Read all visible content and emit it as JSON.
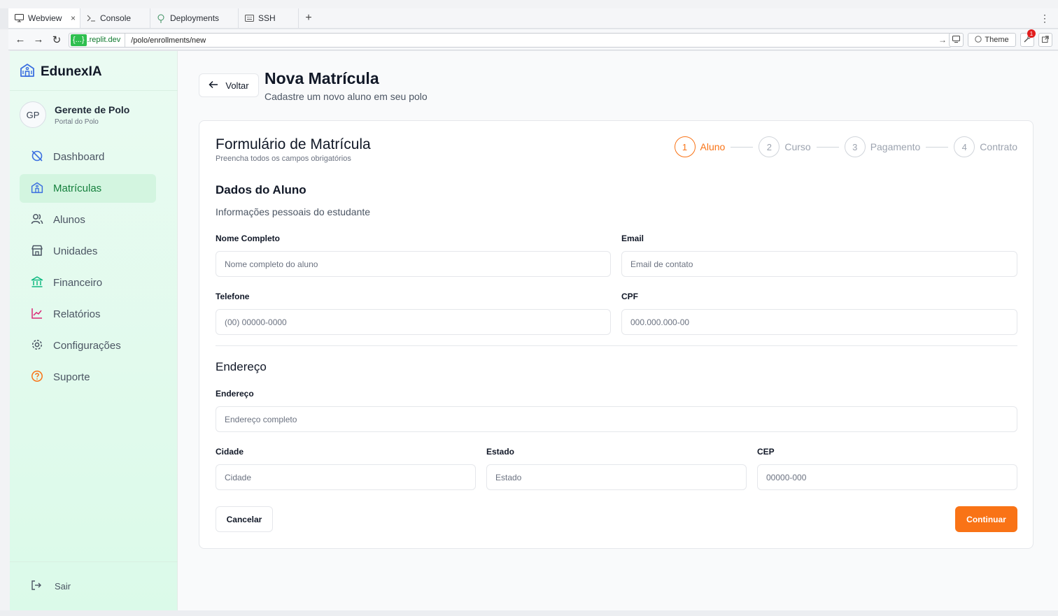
{
  "browser": {
    "tabs": [
      {
        "label": "Webview",
        "icon": "monitor-icon"
      },
      {
        "label": "Console",
        "icon": "terminal-icon"
      },
      {
        "label": "Deployments",
        "icon": "deploy-icon"
      },
      {
        "label": "SSH",
        "icon": "keyboard-icon"
      }
    ],
    "tab_close": "×",
    "new_tab": "+",
    "url_host_badge": "{...}",
    "url_domain": ".replit.dev",
    "url_path": "/polo/enrollments/new",
    "theme_label": "Theme",
    "notification_count": "1"
  },
  "sidebar": {
    "brand": "EdunexIA",
    "user": {
      "initials": "GP",
      "name": "Gerente de Polo",
      "role": "Portal do Polo"
    },
    "items": [
      {
        "label": "Dashboard",
        "icon": "dashboard-icon",
        "color": "#3b6fe0"
      },
      {
        "label": "Matrículas",
        "icon": "enrollments-icon",
        "color": "#3b6fe0"
      },
      {
        "label": "Alunos",
        "icon": "users-icon",
        "color": "#4b5563"
      },
      {
        "label": "Unidades",
        "icon": "store-icon",
        "color": "#4b5563"
      },
      {
        "label": "Financeiro",
        "icon": "bank-icon",
        "color": "#10b981"
      },
      {
        "label": "Relatórios",
        "icon": "chart-line-icon",
        "color": "#db2777"
      },
      {
        "label": "Configurações",
        "icon": "gear-icon",
        "color": "#4b5563"
      },
      {
        "label": "Suporte",
        "icon": "help-circle-icon",
        "color": "#f97316"
      }
    ],
    "active_item": "Matrículas",
    "logout_label": "Sair"
  },
  "header": {
    "back_label": "Voltar",
    "title": "Nova Matrícula",
    "subtitle": "Cadastre um novo aluno em seu polo"
  },
  "form": {
    "title": "Formulário de Matrícula",
    "subtitle": "Preencha todos os campos obrigatórios",
    "steps": [
      {
        "num": "1",
        "label": "Aluno"
      },
      {
        "num": "2",
        "label": "Curso"
      },
      {
        "num": "3",
        "label": "Pagamento"
      },
      {
        "num": "4",
        "label": "Contrato"
      }
    ],
    "active_step": "Aluno",
    "section_student": {
      "title": "Dados do Aluno",
      "description": "Informações pessoais do estudante"
    },
    "fields": {
      "name": {
        "label": "Nome Completo",
        "placeholder": "Nome completo do aluno",
        "value": ""
      },
      "email": {
        "label": "Email",
        "placeholder": "Email de contato",
        "value": ""
      },
      "phone": {
        "label": "Telefone",
        "placeholder": "(00) 00000-0000",
        "value": ""
      },
      "cpf": {
        "label": "CPF",
        "placeholder": "000.000.000-00",
        "value": ""
      },
      "address": {
        "label": "Endereço",
        "placeholder": "Endereço completo",
        "value": ""
      },
      "city": {
        "label": "Cidade",
        "placeholder": "Cidade",
        "value": ""
      },
      "state": {
        "label": "Estado",
        "placeholder": "Estado",
        "value": ""
      },
      "zip": {
        "label": "CEP",
        "placeholder": "00000-000",
        "value": ""
      }
    },
    "section_address": {
      "title": "Endereço"
    },
    "cancel_label": "Cancelar",
    "continue_label": "Continuar"
  },
  "colors": {
    "accent": "#f97316",
    "sidebar_active": "#15803d",
    "brand_icon": "#3b6fe0"
  }
}
